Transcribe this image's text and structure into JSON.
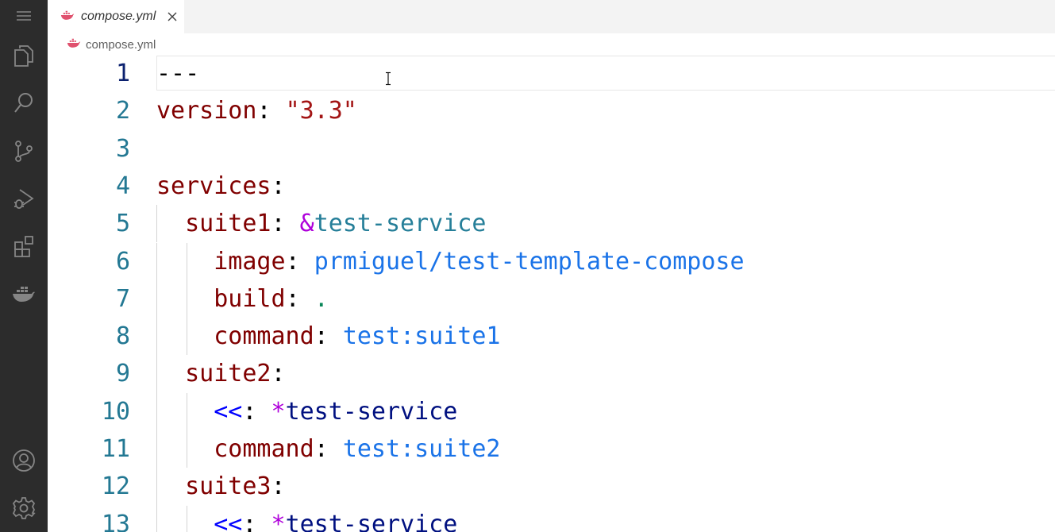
{
  "activity_bar": {
    "icons": [
      "menu-icon",
      "explorer-icon",
      "search-icon",
      "source-control-icon",
      "run-debug-icon",
      "extensions-icon",
      "docker-icon",
      "account-icon",
      "settings-gear-icon"
    ]
  },
  "tab": {
    "label": "compose.yml",
    "icon": "docker-whale-icon"
  },
  "breadcrumb": {
    "label": "compose.yml"
  },
  "editor": {
    "active_line": 1,
    "lines": [
      {
        "n": "1",
        "indent": "",
        "tokens": [
          {
            "t": "---",
            "c": "t-plain"
          }
        ]
      },
      {
        "n": "2",
        "indent": "",
        "tokens": [
          {
            "t": "version",
            "c": "t-key"
          },
          {
            "t": ": ",
            "c": "t-plain"
          },
          {
            "t": "\"3.3\"",
            "c": "t-str"
          }
        ]
      },
      {
        "n": "3",
        "indent": "",
        "tokens": []
      },
      {
        "n": "4",
        "indent": "",
        "tokens": [
          {
            "t": "services",
            "c": "t-key"
          },
          {
            "t": ":",
            "c": "t-plain"
          }
        ]
      },
      {
        "n": "5",
        "indent": "  ",
        "tokens": [
          {
            "t": "suite1",
            "c": "t-key"
          },
          {
            "t": ": ",
            "c": "t-plain"
          },
          {
            "t": "&",
            "c": "t-anchor-sym"
          },
          {
            "t": "test-service",
            "c": "t-anchor-name"
          }
        ]
      },
      {
        "n": "6",
        "indent": "    ",
        "tokens": [
          {
            "t": "image",
            "c": "t-key"
          },
          {
            "t": ": ",
            "c": "t-plain"
          },
          {
            "t": "prmiguel/test-template-compose",
            "c": "t-link"
          }
        ]
      },
      {
        "n": "7",
        "indent": "    ",
        "tokens": [
          {
            "t": "build",
            "c": "t-key"
          },
          {
            "t": ": ",
            "c": "t-plain"
          },
          {
            "t": ".",
            "c": "t-dot"
          }
        ]
      },
      {
        "n": "8",
        "indent": "    ",
        "tokens": [
          {
            "t": "command",
            "c": "t-key"
          },
          {
            "t": ": ",
            "c": "t-plain"
          },
          {
            "t": "test:suite1",
            "c": "t-link"
          }
        ]
      },
      {
        "n": "9",
        "indent": "  ",
        "tokens": [
          {
            "t": "suite2",
            "c": "t-key"
          },
          {
            "t": ":",
            "c": "t-plain"
          }
        ]
      },
      {
        "n": "10",
        "indent": "    ",
        "tokens": [
          {
            "t": "<<",
            "c": "t-merge"
          },
          {
            "t": ": ",
            "c": "t-plain"
          },
          {
            "t": "*",
            "c": "t-anchor-sym"
          },
          {
            "t": "test-service",
            "c": "t-alias-name"
          }
        ]
      },
      {
        "n": "11",
        "indent": "    ",
        "tokens": [
          {
            "t": "command",
            "c": "t-key"
          },
          {
            "t": ": ",
            "c": "t-plain"
          },
          {
            "t": "test:suite2",
            "c": "t-link"
          }
        ]
      },
      {
        "n": "12",
        "indent": "  ",
        "tokens": [
          {
            "t": "suite3",
            "c": "t-key"
          },
          {
            "t": ":",
            "c": "t-plain"
          }
        ]
      },
      {
        "n": "13",
        "indent": "    ",
        "tokens": [
          {
            "t": "<<",
            "c": "t-merge"
          },
          {
            "t": ": ",
            "c": "t-plain"
          },
          {
            "t": "*",
            "c": "t-anchor-sym"
          },
          {
            "t": "test-service",
            "c": "t-alias-name"
          }
        ]
      }
    ]
  },
  "colors": {
    "activity_bar_bg": "#2c2c2c",
    "activity_icon": "#858585",
    "docker_accent": "#e0516e",
    "line_number": "#237893",
    "line_number_active": "#0b216f"
  }
}
